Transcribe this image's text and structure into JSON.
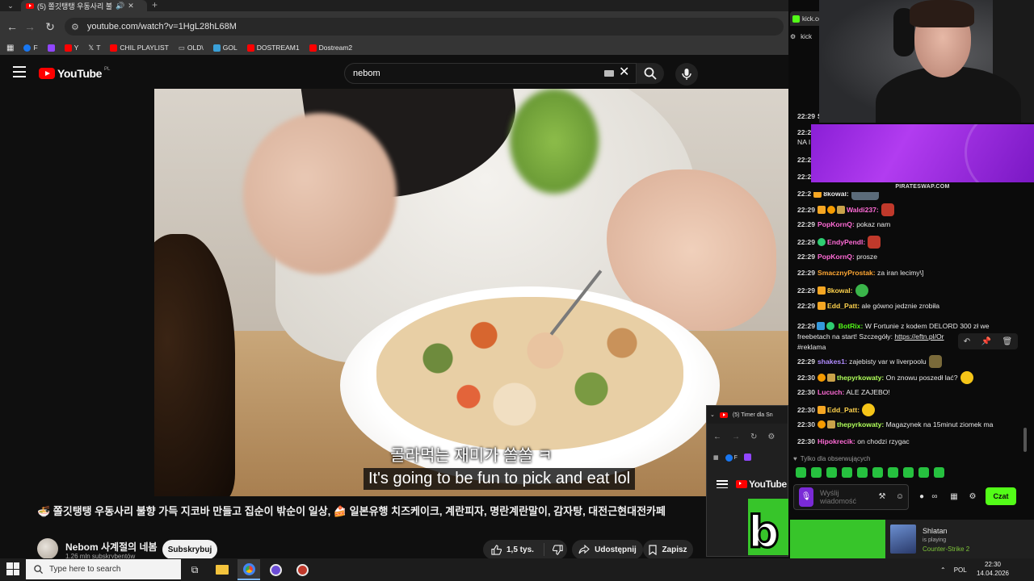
{
  "browser": {
    "tab_title": "(5) 쫄깃탱탱 우동사리 불",
    "url": "youtube.com/watch?v=1HgL28hL68M",
    "bookmarks": [
      {
        "label": "F",
        "color": "#1877f2"
      },
      {
        "label": "",
        "color": "#9146ff"
      },
      {
        "label": "Y",
        "color": "#ff0000"
      },
      {
        "label": "T",
        "color": "#ffffff"
      },
      {
        "label": "CHIL PLAYLIST",
        "color": "#ff0000"
      },
      {
        "label": "OLD\\",
        "color": "#cccccc"
      },
      {
        "label": "GOL",
        "color": "#3aa0d8"
      },
      {
        "label": "DOSTREAM1",
        "color": "#ff0000"
      },
      {
        "label": "Dostream2",
        "color": "#ff0000"
      }
    ]
  },
  "youtube": {
    "logo": "YouTube",
    "country": "PL",
    "search_value": "nebom",
    "subtitle_kr": "골라먹는 재미가 쏠쏠 ㅋ",
    "subtitle_en": "It's going to be fun to pick and eat lol",
    "video_title": "🍜 쫄깃탱탱 우동사리 불향 가득 지코바 만들고 집순이 밖순이 일상, 🍰 일본유행 치즈케이크, 계란피자, 명란계란말이, 감자탕, 대전근현대전카페",
    "channel_name": "Nebom 사계절의 네봄",
    "channel_subs": "1,26 mln subskrybentów",
    "subscribe_label": "Subskrybuj",
    "like_count": "1,5 tys.",
    "share_label": "Udostępnij",
    "save_label": "Zapisz"
  },
  "kick": {
    "tab_label": "kick.co",
    "url_short": "kick",
    "promo_label": "PIRATESWAP.COM",
    "messages": [
      {
        "time": "22:29",
        "user": "S",
        "color": "#e8e8e8",
        "text": ""
      },
      {
        "time": "22:2",
        "user": "",
        "color": "#e8e8e8",
        "text": "NA I"
      },
      {
        "time": "22:2",
        "user": "",
        "color": "#e8e8e8",
        "text": ""
      },
      {
        "time": "22:2",
        "user": "",
        "color": "#e8e8e8",
        "text": ""
      },
      {
        "time": "22:2",
        "user": "8kowal:",
        "color": "#e8e8e8",
        "text": ""
      },
      {
        "time": "22:29",
        "user": "Waldi237:",
        "color": "#ff6bd6",
        "text": ""
      },
      {
        "time": "22:29",
        "user": "PopKornQ:",
        "color": "#ff6bd6",
        "text": "pokaz nam"
      },
      {
        "time": "22:29",
        "user": "EndyPendl:",
        "color": "#ff6bd6",
        "text": ""
      },
      {
        "time": "22:29",
        "user": "PopKornQ:",
        "color": "#ff6bd6",
        "text": "prosze"
      },
      {
        "time": "22:29",
        "user": "SmacznyProstak:",
        "color": "#ffa733",
        "text": "za iran lecimy\\]"
      },
      {
        "time": "22:29",
        "user": "8kowal:",
        "color": "#ffd34d",
        "text": ""
      },
      {
        "time": "22:29",
        "user": "Edd_Patt:",
        "color": "#ffd34d",
        "text": "ale gówno jedznie zrobiła"
      }
    ],
    "botrix": {
      "time": "22:29",
      "user": "BotRix:",
      "text": "W Fortunie z kodem DELORD 300 zł we freebetach na start! Szczegóły:",
      "link": "https://eftn.pl/Or",
      "tag": "#reklama"
    },
    "messages2": [
      {
        "time": "22:29",
        "user": "shakes1:",
        "color": "#b18cff",
        "text": "zajebisty var w liverpoolu"
      },
      {
        "time": "22:30",
        "user": "thepyrkowaty:",
        "color": "#b0ff5a",
        "text": "On znowu poszedł lać?"
      },
      {
        "time": "22:30",
        "user": "Lucuch:",
        "color": "#ff6bd6",
        "text": "ALE ZAJEBO!"
      },
      {
        "time": "22:30",
        "user": "Edd_Patt:",
        "color": "#ffd34d",
        "text": ""
      },
      {
        "time": "22:30",
        "user": "thepyrkowaty:",
        "color": "#b0ff5a",
        "text": "Magazynek na 15minut ziomek ma"
      },
      {
        "time": "22:30",
        "user": "Hipokrecik:",
        "color": "#ff6bd6",
        "text": "on chodzi rzygac"
      }
    ],
    "followers_only": "Tylko dla obserwujących",
    "input_placeholder": "Wyślij wiadomość",
    "send_label": "Czat"
  },
  "mini_window": {
    "tab_title": "(5) Timer dla Sn",
    "yt_logo": "YouTube",
    "bookmark_f": "F"
  },
  "notification": {
    "name": "Shlatan",
    "status": "is playing",
    "game": "Counter-Strike 2"
  },
  "taskbar": {
    "search_placeholder": "Type here to search",
    "lang": "POL",
    "time": "22:30",
    "date": "14.04.2026"
  }
}
